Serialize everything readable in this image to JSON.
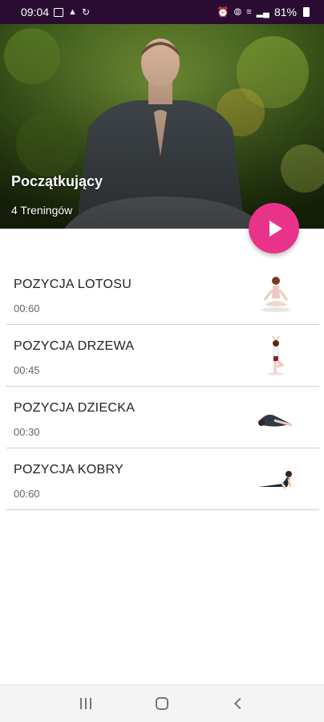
{
  "status_bar": {
    "time": "09:04",
    "battery": "81%",
    "left_icons": [
      "image-icon",
      "notification-icon",
      "sync-icon"
    ],
    "right_icons": [
      "alarm-icon",
      "hotspot-icon",
      "wifi-icon",
      "signal-icon",
      "battery-icon"
    ]
  },
  "hero": {
    "title": "Początkujący",
    "subtitle": "4 Treningów"
  },
  "play_button": {
    "icon": "play-icon",
    "color": "#e9338a"
  },
  "exercises": [
    {
      "name": "POZYCJA LOTOSU",
      "duration": "00:60",
      "icon": "lotus-pose-icon"
    },
    {
      "name": "POZYCJA DRZEWA",
      "duration": "00:45",
      "icon": "tree-pose-icon"
    },
    {
      "name": "POZYCJA DZIECKA",
      "duration": "00:30",
      "icon": "child-pose-icon"
    },
    {
      "name": "POZYCJA KOBRY",
      "duration": "00:60",
      "icon": "cobra-pose-icon"
    }
  ],
  "nav_bar": {
    "buttons": [
      "recents-icon",
      "home-icon",
      "back-icon"
    ]
  }
}
